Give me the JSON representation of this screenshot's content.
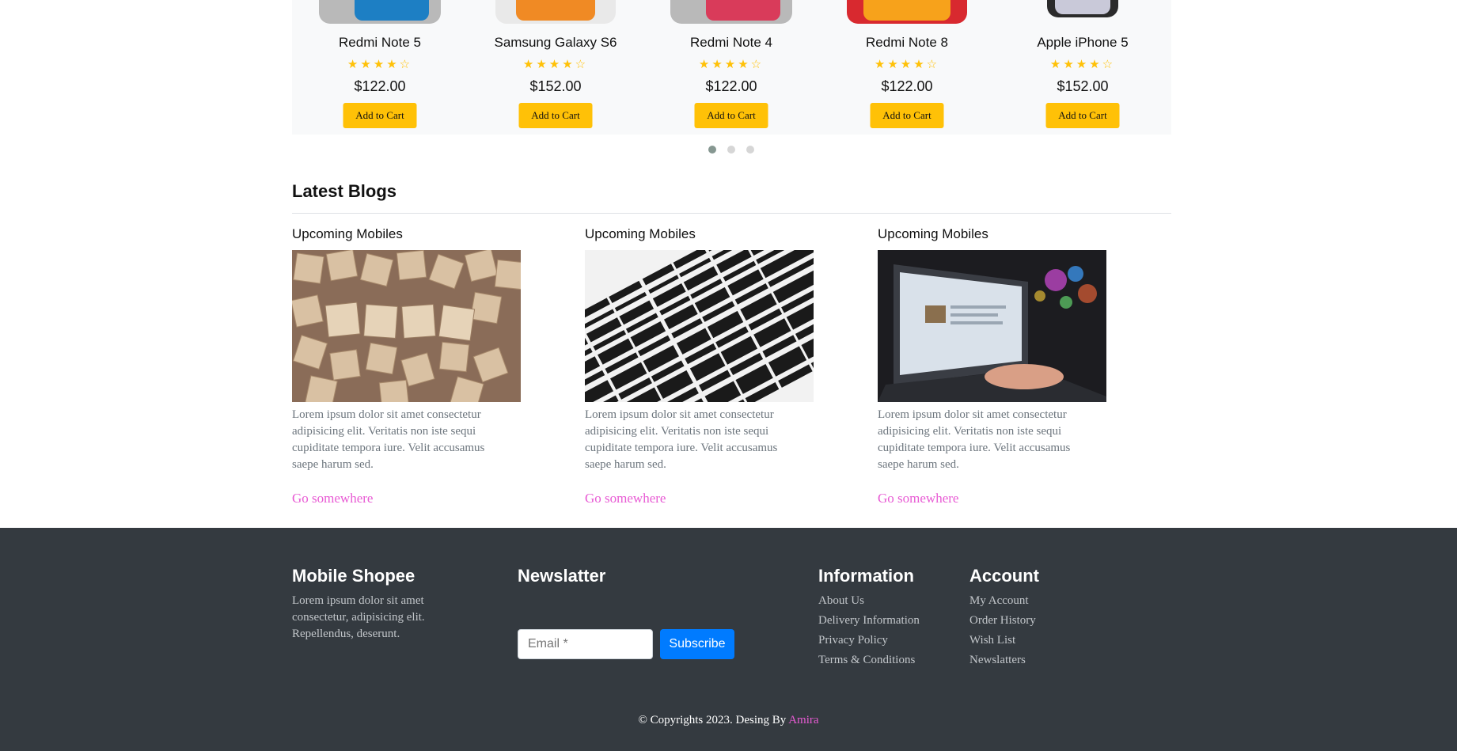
{
  "products": [
    {
      "name": "Redmi Note 5",
      "price": "$122.00",
      "rating": 4,
      "max_rating": 5,
      "button": "Add to Cart",
      "body_color": "#b9b9b9",
      "screen_color": "#1d7fc4"
    },
    {
      "name": "Samsung Galaxy S6",
      "price": "$152.00",
      "rating": 4,
      "max_rating": 5,
      "button": "Add to Cart",
      "body_color": "#e9e9e9",
      "screen_color": "#f08a24"
    },
    {
      "name": "Redmi Note 4",
      "price": "$122.00",
      "rating": 4,
      "max_rating": 5,
      "button": "Add to Cart",
      "body_color": "#b9b9b9",
      "screen_color": "#d93b5a"
    },
    {
      "name": "Redmi Note 8",
      "price": "$122.00",
      "rating": 4,
      "max_rating": 5,
      "button": "Add to Cart",
      "body_color": "#d8292f",
      "screen_color": "#f7a21b"
    },
    {
      "name": "Apple iPhone 5",
      "price": "$152.00",
      "rating": 4,
      "max_rating": 5,
      "button": "Add to Cart",
      "body_color": "#2b2b2b",
      "screen_color": "#c9c9d9"
    }
  ],
  "carousel": {
    "page_count": 3,
    "active_page": 1
  },
  "blogs": {
    "section_title": "Latest Blogs",
    "items": [
      {
        "title": "Upcoming Mobiles",
        "image": "blog-tiles-image",
        "text": "Lorem ipsum dolor sit amet consectetur adipisicing elit. Veritatis non iste sequi cupiditate tempora iure. Velit accusamus saepe harum sed.",
        "link": "Go somewhere"
      },
      {
        "title": "Upcoming Mobiles",
        "image": "web-words-image",
        "text": "Lorem ipsum dolor sit amet consectetur adipisicing elit. Veritatis non iste sequi cupiditate tempora iure. Velit accusamus saepe harum sed.",
        "link": "Go somewhere"
      },
      {
        "title": "Upcoming Mobiles",
        "image": "laptop-image",
        "text": "Lorem ipsum dolor sit amet consectetur adipisicing elit. Veritatis non iste sequi cupiditate tempora iure. Velit accusamus saepe harum sed.",
        "link": "Go somewhere"
      }
    ]
  },
  "footer": {
    "brand": {
      "title": "Mobile Shopee",
      "text": "Lorem ipsum dolor sit amet consectetur, adipisicing elit. Repellendus, deserunt."
    },
    "newsletter": {
      "title": "Newslatter",
      "email_placeholder": "Email *",
      "button": "Subscribe"
    },
    "information": {
      "title": "Information",
      "links": [
        "About Us",
        "Delivery Information",
        "Privacy Policy",
        "Terms & Conditions"
      ]
    },
    "account": {
      "title": "Account",
      "links": [
        "My Account",
        "Order History",
        "Wish List",
        "Newslatters"
      ]
    },
    "copyright": {
      "text": "© Copyrights 2023. Desing By ",
      "author": "Amira"
    }
  },
  "colors": {
    "accent_yellow": "#ffc107",
    "link_pink": "#e85bd4",
    "primary_blue": "#007bff",
    "footer_bg": "#343a40"
  }
}
